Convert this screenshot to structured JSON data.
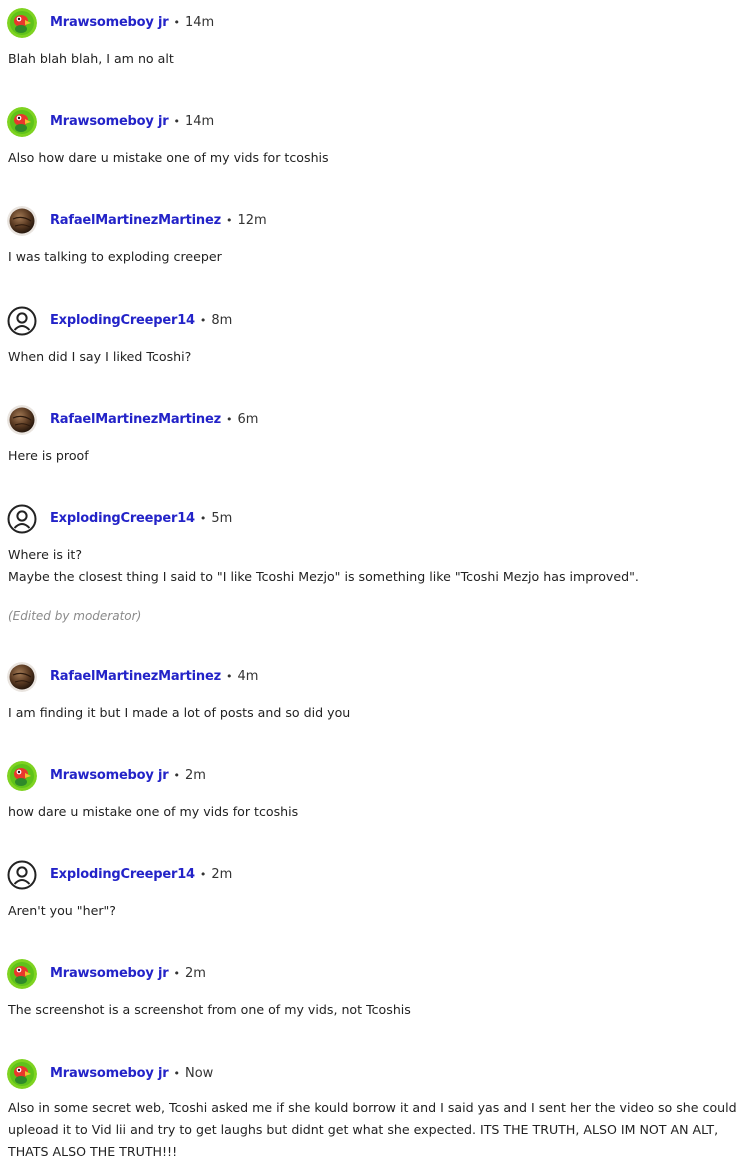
{
  "comments": [
    {
      "user": "Mrawsomeboy jr",
      "avatar": "parrot-icon",
      "time": "14m",
      "lines": [
        "Blah blah blah, I am no alt"
      ]
    },
    {
      "user": "Mrawsomeboy jr",
      "avatar": "parrot-icon",
      "time": "14m",
      "lines": [
        "Also how dare u mistake one of my vids for tcoshis"
      ]
    },
    {
      "user": "RafaelMartinezMartinez",
      "avatar": "brown-orb-icon",
      "time": "12m",
      "lines": [
        "I was talking to exploding creeper"
      ]
    },
    {
      "user": "ExplodingCreeper14",
      "avatar": "default-user-icon",
      "time": "8m",
      "lines": [
        "When did I say I liked Tcoshi?"
      ]
    },
    {
      "user": "RafaelMartinezMartinez",
      "avatar": "brown-orb-icon",
      "time": "6m",
      "lines": [
        "Here is proof"
      ]
    },
    {
      "user": "ExplodingCreeper14",
      "avatar": "default-user-icon",
      "time": "5m",
      "lines": [
        "Where is it?",
        "Maybe the closest thing I said to \"I like Tcoshi Mezjo\" is something like \"Tcoshi Mezjo has improved\"."
      ],
      "edited": "(Edited by moderator)"
    },
    {
      "user": "RafaelMartinezMartinez",
      "avatar": "brown-orb-icon",
      "time": "4m",
      "lines": [
        "I am finding it but I made a lot of posts and so did you"
      ]
    },
    {
      "user": "Mrawsomeboy jr",
      "avatar": "parrot-icon",
      "time": "2m",
      "lines": [
        "how dare u mistake one of my vids for tcoshis"
      ]
    },
    {
      "user": "ExplodingCreeper14",
      "avatar": "default-user-icon",
      "time": "2m",
      "lines": [
        "Aren't you \"her\"?"
      ]
    },
    {
      "user": "Mrawsomeboy jr",
      "avatar": "parrot-icon",
      "time": "2m",
      "lines": [
        "The screenshot is a screenshot from one of my vids, not Tcoshis"
      ]
    },
    {
      "user": "Mrawsomeboy jr",
      "avatar": "parrot-icon",
      "time": "Now",
      "lines": [
        "Also in some secret web, Tcoshi asked me if she kould borrow it and I said yas and I sent her the video so she could upleoad it to Vid lii and try to get laughs but didnt get what she expected. ITS THE TRUTH, ALSO IM NOT AN ALT, THATS ALSO THE TRUTH!!!"
      ]
    }
  ],
  "separator": "•",
  "colors": {
    "username": "#2323c8",
    "text": "#222222",
    "muted": "#8a8a8a",
    "parrot_bg": "#6ccf2e",
    "orb_bg": "#5a3a22"
  }
}
